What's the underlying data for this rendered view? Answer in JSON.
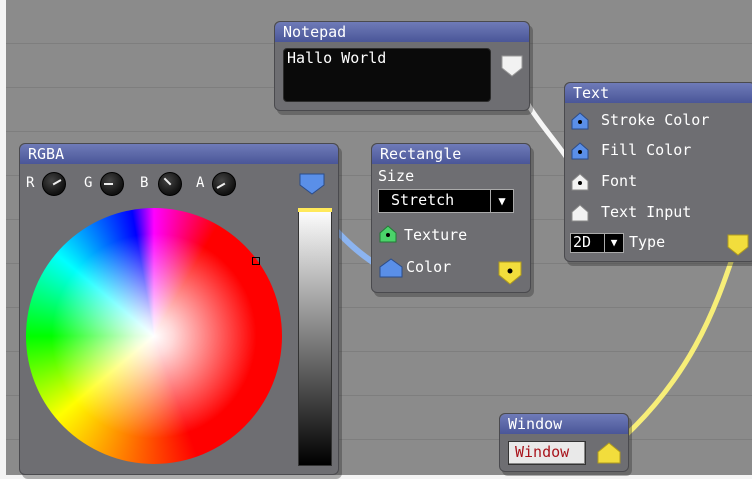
{
  "nodes": {
    "notepad": {
      "title": "Notepad",
      "text": "Hallo World"
    },
    "text": {
      "title": "Text",
      "inputs": [
        "Stroke Color",
        "Fill Color",
        "Font",
        "Text Input"
      ],
      "type_select": "2D",
      "type_label": "Type"
    },
    "rgba": {
      "title": "RGBA",
      "knobs": [
        "R",
        "G",
        "B",
        "A"
      ]
    },
    "rectangle": {
      "title": "Rectangle",
      "size_label": "Size",
      "size_value": "Stretch",
      "texture_label": "Texture",
      "color_label": "Color"
    },
    "window": {
      "title": "Window",
      "button": "Window"
    }
  },
  "colors": {
    "title_bar": "#5664a8",
    "pin_blue": "#5a8fe8",
    "pin_white": "#f2f2f2",
    "pin_green": "#4bd36a",
    "pin_yellow": "#f2dd3c",
    "link_white": "#f6f6f6",
    "link_blue": "#8cb4f0",
    "link_yellow": "#f7ee78"
  }
}
